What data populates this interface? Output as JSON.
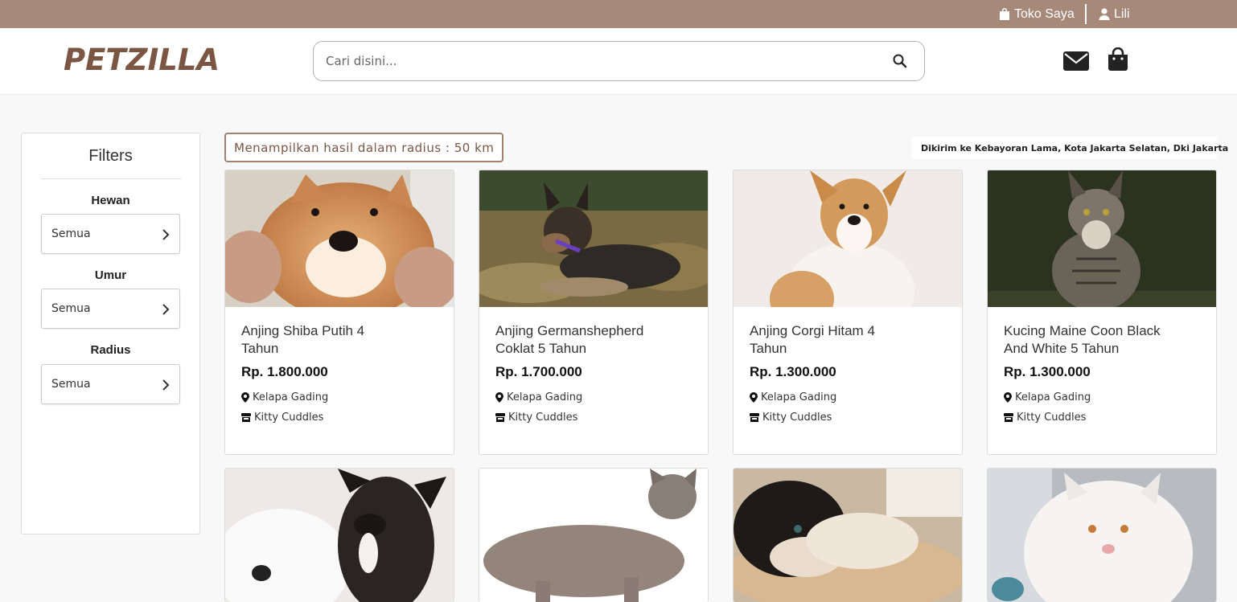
{
  "topbar": {
    "shop_label": "Toko Saya",
    "user_label": "Lili",
    "bg_color": "#a68978"
  },
  "header": {
    "logo": "PETZILLA",
    "search_placeholder": "Cari disini..."
  },
  "filters": {
    "title": "Filters",
    "groups": [
      {
        "label": "Hewan",
        "value": "Semua"
      },
      {
        "label": "Umur",
        "value": "Semua"
      },
      {
        "label": "Radius",
        "value": "Semua"
      }
    ]
  },
  "results": {
    "radius_text": "Menampilkan hasil dalam radius : 50 km",
    "shipping_text": "Dikirim ke Kebayoran Lama, Kota Jakarta Selatan, Dki Jakarta"
  },
  "products": [
    {
      "name": "Anjing Shiba Putih 4 Tahun",
      "price": "Rp. 1.800.000",
      "location": "Kelapa Gading",
      "shop": "Kitty Cuddles"
    },
    {
      "name": "Anjing Germanshepherd Coklat 5 Tahun",
      "price": "Rp. 1.700.000",
      "location": "Kelapa Gading",
      "shop": "Kitty Cuddles"
    },
    {
      "name": "Anjing Corgi Hitam 4 Tahun",
      "price": "Rp. 1.300.000",
      "location": "Kelapa Gading",
      "shop": "Kitty Cuddles"
    },
    {
      "name": "Kucing Maine Coon Black And White 5 Tahun",
      "price": "Rp. 1.300.000",
      "location": "Kelapa Gading",
      "shop": "Kitty Cuddles"
    }
  ],
  "colors": {
    "brand": "#7b5643",
    "accent_border": "#a1826f"
  }
}
